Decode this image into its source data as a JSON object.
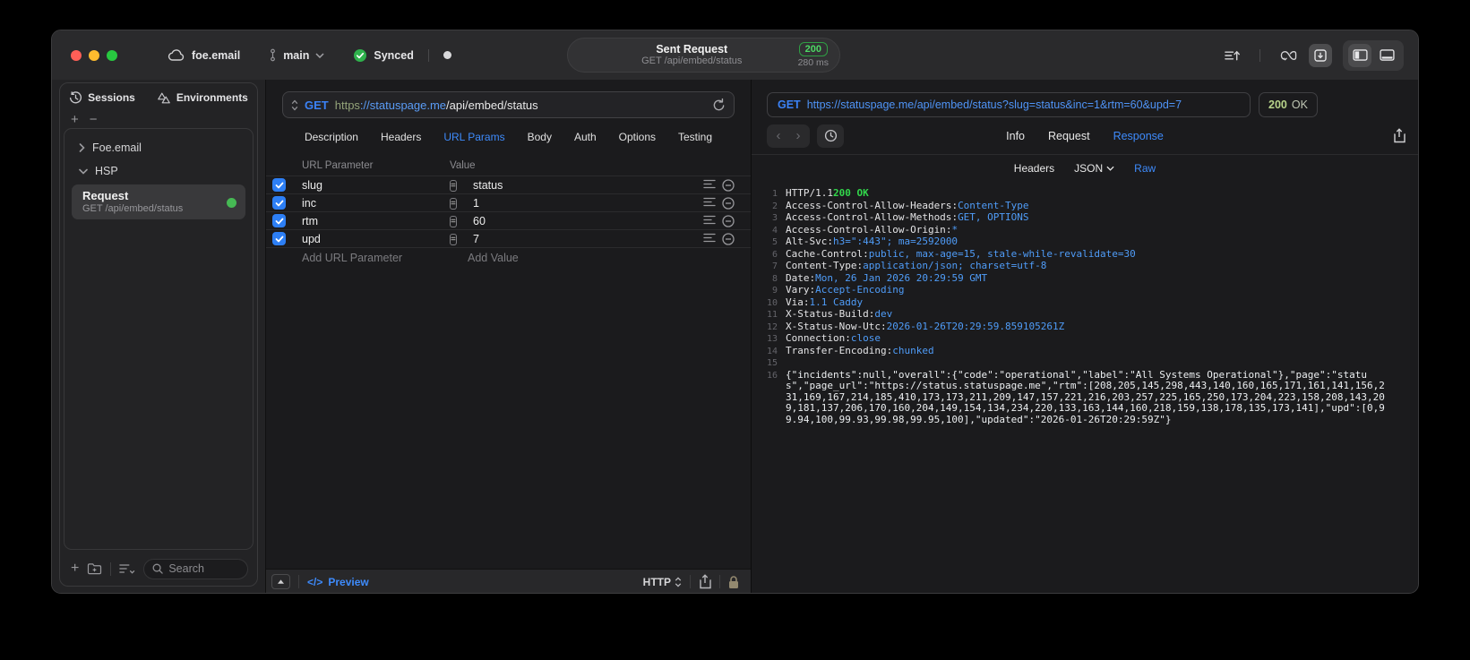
{
  "colors": {
    "accent_blue": "#3e8bfc",
    "method_blue": "#3b82f6",
    "success_green": "#32d74b",
    "status_pale_green": "#b7d38a",
    "checkbox_blue": "#2d7ff5"
  },
  "titlebar": {
    "project": "foe.email",
    "branch": "main",
    "sync_status": "Synced",
    "center": {
      "title": "Sent Request",
      "subtitle": "GET /api/embed/status",
      "status_code": "200",
      "duration": "280 ms"
    }
  },
  "sidebar": {
    "tabs": [
      {
        "label": "Sessions"
      },
      {
        "label": "Environments"
      }
    ],
    "tree": [
      {
        "label": "Foe.email"
      },
      {
        "label": "HSP"
      }
    ],
    "request_item": {
      "title": "Request",
      "subtitle": "GET /api/embed/status"
    },
    "search_placeholder": "Search"
  },
  "request_panel": {
    "method": "GET",
    "url_scheme": "https",
    "url_host": "://statuspage.me",
    "url_path": "/api/embed/status",
    "tabs": [
      "Description",
      "Headers",
      "URL Params",
      "Body",
      "Auth",
      "Options",
      "Testing"
    ],
    "active_tab": "URL Params",
    "param_table": {
      "columns": [
        "URL Parameter",
        "Value"
      ],
      "rows": [
        {
          "name": "slug",
          "value": "status"
        },
        {
          "name": "inc",
          "value": "1"
        },
        {
          "name": "rtm",
          "value": "60"
        },
        {
          "name": "upd",
          "value": "7"
        }
      ],
      "add_name_placeholder": "Add URL Parameter",
      "add_value_placeholder": "Add Value"
    },
    "footer": {
      "code_icon": "</>",
      "preview_label": "Preview",
      "http_label": "HTTP"
    }
  },
  "response_panel": {
    "method": "GET",
    "url": "https://statuspage.me/api/embed/status?slug=status&inc=1&rtm=60&upd=7",
    "status_code": "200",
    "status_text": "OK",
    "tabs": [
      "Info",
      "Request",
      "Response"
    ],
    "active_tab": "Response",
    "view_tabs": [
      "Headers",
      "JSON",
      "Raw"
    ],
    "active_view": "Raw",
    "status_line": {
      "protocol": "HTTP/1.1",
      "status": "200 OK"
    },
    "headers": [
      {
        "name": "Access-Control-Allow-Headers",
        "value": "Content-Type"
      },
      {
        "name": "Access-Control-Allow-Methods",
        "value": "GET, OPTIONS"
      },
      {
        "name": "Access-Control-Allow-Origin",
        "value": "*"
      },
      {
        "name": "Alt-Svc",
        "value": "h3=\":443\"; ma=2592000"
      },
      {
        "name": "Cache-Control",
        "value": "public, max-age=15, stale-while-revalidate=30"
      },
      {
        "name": "Content-Type",
        "value": "application/json; charset=utf-8"
      },
      {
        "name": "Date",
        "value": "Mon, 26 Jan 2026 20:29:59 GMT"
      },
      {
        "name": "Vary",
        "value": "Accept-Encoding"
      },
      {
        "name": "Via",
        "value": "1.1 Caddy"
      },
      {
        "name": "X-Status-Build",
        "value": "dev"
      },
      {
        "name": "X-Status-Now-Utc",
        "value": "2026-01-26T20:29:59.859105261Z"
      },
      {
        "name": "Connection",
        "value": "close"
      },
      {
        "name": "Transfer-Encoding",
        "value": "chunked"
      }
    ],
    "body": "{\"incidents\":null,\"overall\":{\"code\":\"operational\",\"label\":\"All Systems Operational\"},\"page\":\"status\",\"page_url\":\"https://status.statuspage.me\",\"rtm\":[208,205,145,298,443,140,160,165,171,161,141,156,231,169,167,214,185,410,173,173,211,209,147,157,221,216,203,257,225,165,250,173,204,223,158,208,143,209,181,137,206,170,160,204,149,154,134,234,220,133,163,144,160,218,159,138,178,135,173,141],\"upd\":[0,99.94,100,99.93,99.98,99.95,100],\"updated\":\"2026-01-26T20:29:59Z\"}"
  }
}
